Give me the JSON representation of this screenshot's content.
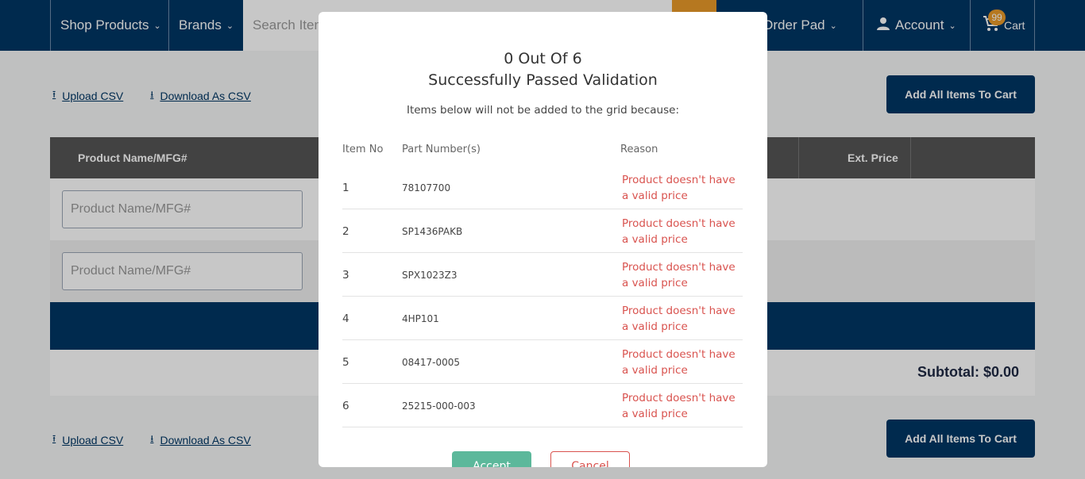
{
  "header": {
    "shop_products": "Shop Products",
    "brands": "Brands",
    "search_placeholder": "Search Items",
    "quick_order_pad": "Quick Order Pad",
    "account": "Account",
    "cart_label": "Cart",
    "cart_count": "99"
  },
  "actions": {
    "upload_csv": "Upload CSV",
    "download_csv": "Download As CSV",
    "add_all": "Add All Items To Cart"
  },
  "grid": {
    "col_product": "Product Name/MFG#",
    "col_ext_price": "Ext. Price",
    "input_placeholder": "Product Name/MFG#",
    "subtotal": "Subtotal: $0.00"
  },
  "modal": {
    "title_line1": "0 Out Of 6",
    "title_line2": "Successfully Passed Validation",
    "subtitle": "Items below will not be added to the grid because:",
    "col_item_no": "Item No",
    "col_part": "Part Number(s)",
    "col_reason": "Reason",
    "rows": [
      {
        "no": "1",
        "part": "78107700",
        "reason": "Product doesn't have a valid price"
      },
      {
        "no": "2",
        "part": "SP1436PAKB",
        "reason": "Product doesn't have a valid price"
      },
      {
        "no": "3",
        "part": "SPX1023Z3",
        "reason": "Product doesn't have a valid price"
      },
      {
        "no": "4",
        "part": "4HP101",
        "reason": "Product doesn't have a valid price"
      },
      {
        "no": "5",
        "part": "08417-0005",
        "reason": "Product doesn't have a valid price"
      },
      {
        "no": "6",
        "part": "25215-000-003",
        "reason": "Product doesn't have a valid price"
      }
    ],
    "accept": "Accept",
    "cancel": "Cancel"
  }
}
